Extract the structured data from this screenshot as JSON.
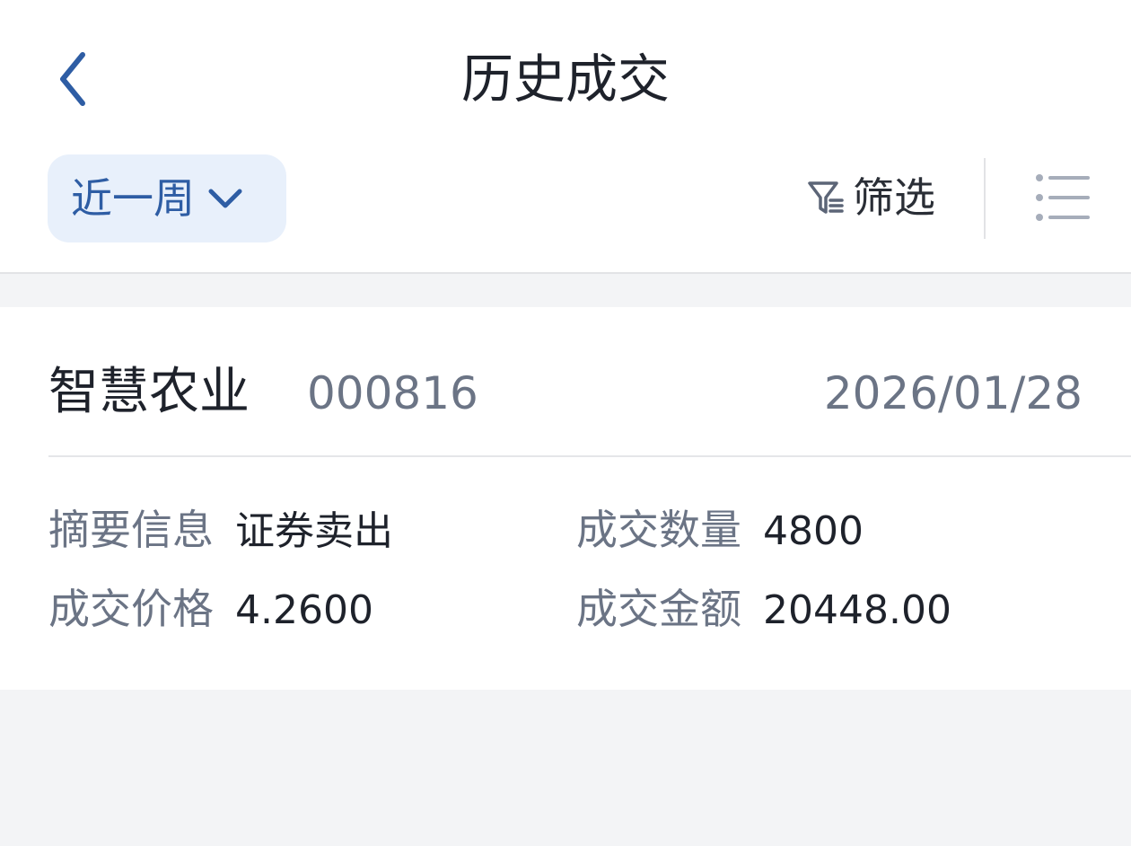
{
  "header": {
    "title": "历史成交",
    "period_label": "近一周",
    "filter_label": "筛选"
  },
  "icons": {
    "back": "chevron-left-icon",
    "period_dropdown": "chevron-down-icon",
    "filter": "filter-icon",
    "list": "list-icon"
  },
  "colors": {
    "accent": "#2e5da4",
    "accent_bg": "#e8f0fb",
    "text_primary": "#1e222b",
    "text_secondary": "#6b7485",
    "page_bg": "#f3f4f6"
  },
  "trades": [
    {
      "name": "智慧农业",
      "code": "000816",
      "date": "2026/01/28",
      "summary_label": "摘要信息",
      "summary_value": "证券卖出",
      "quantity_label": "成交数量",
      "quantity_value": "4800",
      "price_label": "成交价格",
      "price_value": "4.2600",
      "amount_label": "成交金额",
      "amount_value": "20448.00"
    }
  ]
}
